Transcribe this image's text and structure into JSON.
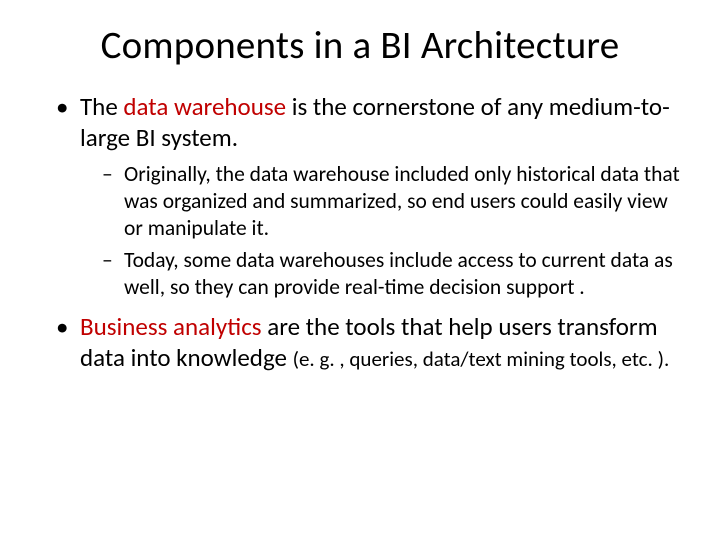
{
  "title": "Components in a BI Architecture",
  "bullets": {
    "b1_pre": "The ",
    "b1_red": "data warehouse",
    "b1_post": " is the cornerstone of any medium-to-large BI system.",
    "b1_sub1": "Originally, the data warehouse included only historical data that was organized and summarized, so end users could easily view or manipulate it.",
    "b1_sub2": "Today, some data warehouses include access to current data as well, so they can provide real-time decision support .",
    "b2_red": "Business analytics",
    "b2_mid": " are the tools  that help users transform data into knowledge ",
    "b2_tail": "(e. g. , queries, data/text mining tools, etc. )."
  }
}
